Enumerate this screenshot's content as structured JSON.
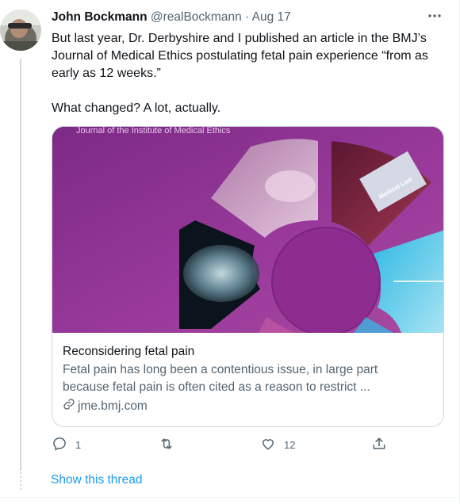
{
  "tweet": {
    "author_name": "John Bockmann",
    "author_handle": "@realBockmann",
    "separator": "·",
    "date": "Aug 17",
    "more_icon": "more-horizontal-icon",
    "text_line1": "But last year, Dr. Derbyshire and I published an article in the BMJ’s Journal of Medical Ethics postulating fetal pain experience “from as early as 12 weeks.”",
    "text_line2": "What changed? A lot, actually."
  },
  "card": {
    "image_header_text": "Journal of the Institute of Medical Ethics",
    "image_book_text": "Medical Law",
    "title": "Reconsidering fetal pain",
    "description_line1": "Fetal pain has long been a contentious issue, in large part",
    "description_line2": "because fetal pain is often cited as a reason to restrict ...",
    "domain": "jme.bmj.com",
    "link_icon": "link-icon"
  },
  "actions": {
    "reply_count": "1",
    "retweet_count": "",
    "like_count": "12",
    "share_count": ""
  },
  "thread": {
    "show_thread_label": "Show this thread"
  },
  "colors": {
    "link_blue": "#1d9bf0",
    "secondary_text": "#536471",
    "primary_text": "#0f1419",
    "border": "#cfd9de",
    "card_image_purple": "#8a2d8f"
  }
}
